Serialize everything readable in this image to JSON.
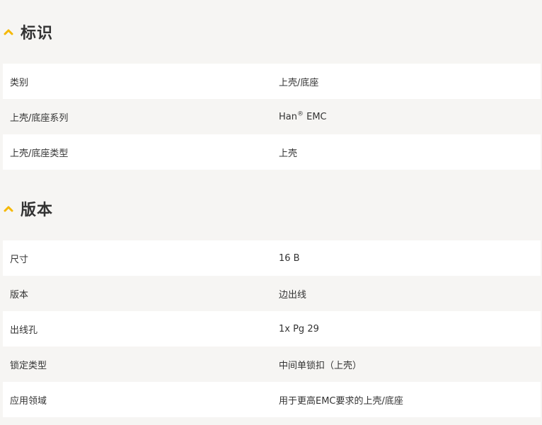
{
  "sections": [
    {
      "title": "标识",
      "rows": [
        {
          "label": "类别",
          "value": "上壳/底座"
        },
        {
          "label": "上壳/底座系列",
          "value": "Han",
          "sup": "®",
          "suffix": " EMC"
        },
        {
          "label": "上壳/底座类型",
          "value": "上壳"
        }
      ]
    },
    {
      "title": "版本",
      "rows": [
        {
          "label": "尺寸",
          "value": "16 B"
        },
        {
          "label": "版本",
          "value": "边出线"
        },
        {
          "label": "出线孔",
          "value": "1x Pg 29"
        },
        {
          "label": "锁定类型",
          "value": "中间单锁扣（上壳）"
        },
        {
          "label": "应用领域",
          "value": "用于更高EMC要求的上壳/底座"
        }
      ]
    }
  ],
  "colors": {
    "accent": "#f5b800",
    "background": "#f6f5f3",
    "row_white": "#ffffff",
    "text": "#333333"
  },
  "icons": {
    "section_toggle": "chevron-up-icon"
  }
}
